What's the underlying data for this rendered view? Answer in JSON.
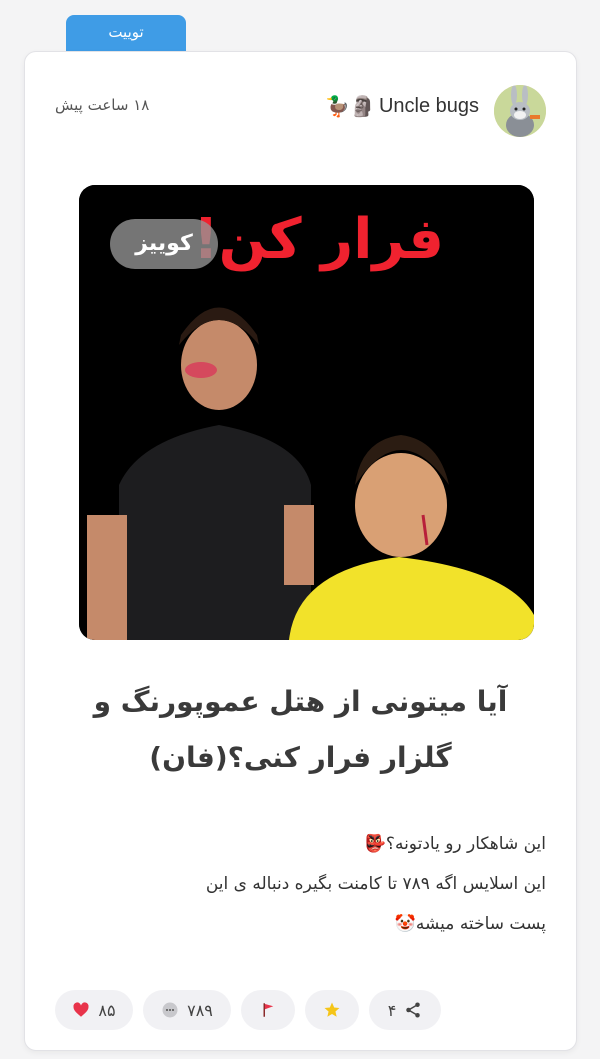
{
  "tab": {
    "label": "توییت",
    "color": "#3f9ce6"
  },
  "post": {
    "author": "Uncle bugs",
    "author_emojis": "🦆🗿",
    "timestamp": "۱۸ ساعت پیش",
    "media": {
      "overlay_title": "فرار کن!",
      "badge": "کوییز"
    },
    "headline_line1": "آیا میتونی از هتل عموپورنگ و",
    "headline_line2": "گلزار فرار کنی؟(فان)",
    "body_line1": "این شاهکار رو یادتونه؟👺",
    "body_line2": "این اسلایس اگه ۷۸۹ تا کامنت بگیره دنباله ی این",
    "body_line3": "پست ساخته میشه🤡"
  },
  "actions": {
    "share_count": "۴",
    "comment_count": "۷۸۹",
    "like_count": "۸۵",
    "share_icon": "share-icon",
    "star_icon": "star-icon",
    "flag_icon": "flag-icon",
    "comment_icon": "comment-icon",
    "like_icon": "heart-icon"
  },
  "colors": {
    "accent": "#3f9ce6",
    "like": "#e8334a",
    "flag": "#e8334a",
    "star": "#f5c518"
  }
}
